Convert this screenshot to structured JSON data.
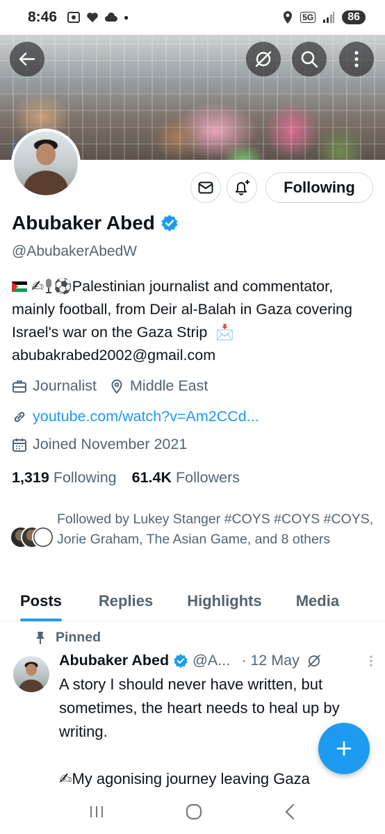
{
  "status_bar": {
    "time": "8:46",
    "network": "5G",
    "battery": "86"
  },
  "profile": {
    "name": "Abubaker Abed",
    "handle": "@AbubakerAbedW",
    "bio_text": "Palestinian journalist and commentator, mainly football, from Deir al-Balah in Gaza covering Israel's war on the Gaza Strip",
    "bio_email": "abubakrabed2002@gmail.com",
    "category": "Journalist",
    "location": "Middle East",
    "link": "youtube.com/watch?v=Am2CCd...",
    "joined": "Joined November 2021",
    "following_count": "1,319",
    "following_label": "Following",
    "followers_count": "61.4K",
    "followers_label": "Followers",
    "followed_by": "Followed by Lukey Stanger #COYS #COYS #COYS, Jorie Graham, The Asian Game, and 8 others",
    "follow_button": "Following"
  },
  "tabs": [
    {
      "label": "Posts",
      "active": true
    },
    {
      "label": "Replies",
      "active": false
    },
    {
      "label": "Highlights",
      "active": false
    },
    {
      "label": "Media",
      "active": false
    }
  ],
  "tweet": {
    "pinned_label": "Pinned",
    "author": "Abubaker Abed",
    "handle_trunc": "@A...",
    "date": "· 12 May",
    "line1": "A story I should never have written, but sometimes, the heart needs to heal up by writing.",
    "line2": "My agonising journey leaving Gaza"
  },
  "colors": {
    "accent": "#1d9bf0",
    "text": "#0f1419",
    "secondary": "#536471"
  }
}
